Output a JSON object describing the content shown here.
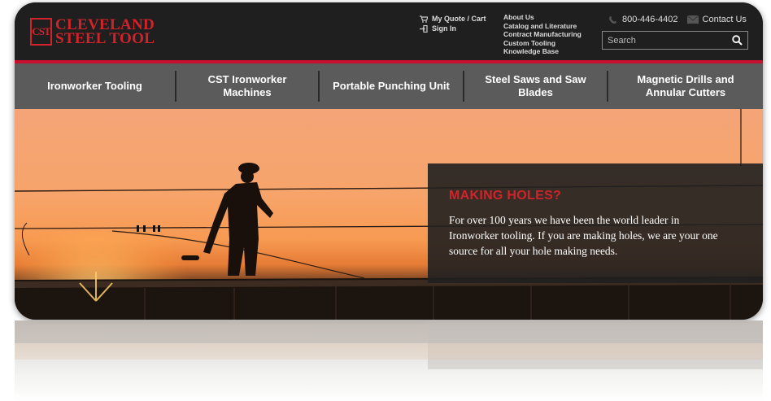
{
  "brand": {
    "mark": "CST",
    "name_line1": "CLEVELAND",
    "name_line2": "STEEL TOOL",
    "color": "#d2232a"
  },
  "header": {
    "quote_label": "My Quote / Cart",
    "sign_in_label": "Sign In",
    "links": [
      "About Us",
      "Catalog and Literature",
      "Contract Manufacturing",
      "Custom Tooling",
      "Knowledge Base"
    ],
    "phone": "800-446-4402",
    "contact_label": "Contact Us",
    "search_placeholder": "Search",
    "icons": [
      "cart-icon",
      "sign-in-icon",
      "phone-icon",
      "mail-icon",
      "search-icon"
    ]
  },
  "nav": {
    "items": [
      {
        "label": "Ironworker Tooling"
      },
      {
        "label": "CST Ironworker Machines"
      },
      {
        "label": "Portable Punching Unit"
      },
      {
        "label": "Steel Saws and Saw Blades"
      },
      {
        "label": "Magnetic Drills and Annular Cutters"
      }
    ]
  },
  "hero": {
    "title": "MAKING HOLES?",
    "body": "For over 100 years we have been the world leader in Ironworker tooling. If you are making holes, we are your one source for all your hole making needs.",
    "accent": "#d2232a"
  }
}
